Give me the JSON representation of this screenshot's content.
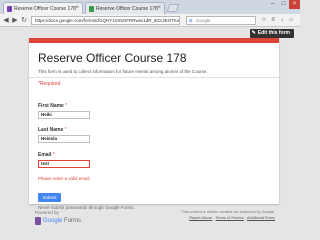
{
  "browser": {
    "tabs": [
      {
        "label": "Reserve Officer Course 178",
        "close": "×"
      },
      {
        "label": "Reserve Officer Course 178",
        "close": "×"
      }
    ],
    "window_controls": {
      "minimize": "–",
      "maximize": "□",
      "close": "×"
    },
    "nav": {
      "back": "◀",
      "forward": "▶",
      "reload": "↻"
    },
    "url": "https://docs.google.com/forms/d/1QHY1nS5OFRRwsx1dR_8Gc2EOTKw8-8Uh4",
    "search_placeholder": "Google",
    "search_engine_glyph": "G"
  },
  "page": {
    "edit_button": "Edit this form",
    "form": {
      "accent_color": "#db4437",
      "title": "Reserve Officer Course 178",
      "description": "This form is used to collect information for future events among alumni of the Course.",
      "required_note": "*Required",
      "fields": {
        "first_name": {
          "label": "First Name",
          "star": "*",
          "value": "Heiki"
        },
        "last_name": {
          "label": "Last Name",
          "star": "*",
          "value": "Heisola"
        },
        "email": {
          "label": "Email",
          "star": "*",
          "value": "test",
          "error": "Please enter a valid email"
        }
      },
      "submit_label": "Submit",
      "password_warning": "Never submit passwords through Google Forms."
    },
    "footer": {
      "powered_by": "Powered by",
      "logo_brand": "Google",
      "logo_product": "Forms",
      "disclaimer": "This content is neither created nor endorsed by Google.",
      "links": [
        "Report Abuse",
        "Terms of Service",
        "Additional Terms"
      ],
      "separator": " - "
    }
  }
}
